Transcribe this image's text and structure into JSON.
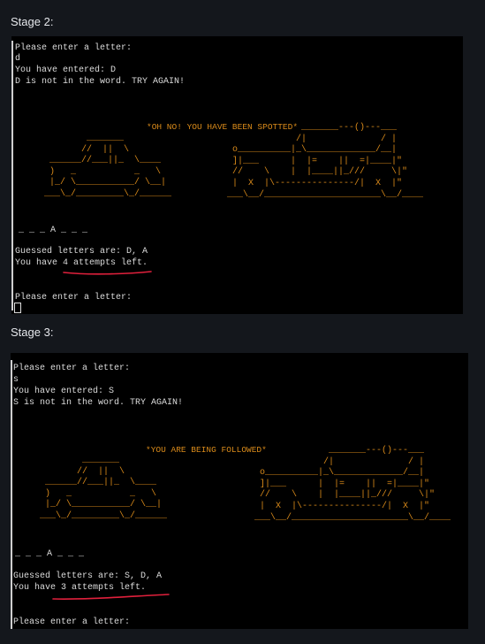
{
  "colors": {
    "page_bg": "#14171c",
    "terminal_bg": "#000000",
    "text": "#dcdcdc",
    "art": "#d98a1a",
    "underline": "#e0203c"
  },
  "stage2": {
    "heading": "Stage 2:",
    "prompt1": "Please enter a letter:",
    "input": "d",
    "entered": "You have entered: D",
    "result": "D is not in the word. TRY AGAIN!",
    "banner": "*OH NO! YOU HAVE BEEN SPOTTED*",
    "word": "_ _ _ A _ _ _",
    "guessed": "Guessed letters are: D, A",
    "attempts_prefix": "You have ",
    "attempts_emph": "4 attempts left.",
    "prompt2": "Please enter a letter:"
  },
  "stage3": {
    "heading": "Stage 3:",
    "prompt1": "Please enter a letter:",
    "input": "s",
    "entered": "You have entered: S",
    "result": "S is not in the word. TRY AGAIN!",
    "banner": "*YOU ARE BEING FOLLOWED*",
    "word": "_ _ _ A _ _ _",
    "guessed": "Guessed letters are: S, D, A",
    "attempts_prefix": "You have ",
    "attempts_emph": "3 attempts left.",
    "prompt2": "Please enter a letter:"
  },
  "art": {
    "car": "        _______\n       //  ||  \\\n ______//___||_  \\____\n )   _           _   \\\n |_/ \\___________/ \\__|\n___\\_/_________\\_/______",
    "van": "              _______---()---___\n             /|              / |\n o__________|_\\_____________/__|\n ]|___      |  |=    ||  =|____|\"\n //    \\    |  |____||_///     \\|\"\n |  X  |\\---------------/|  X  |\"\n___\\__/______________________\\__/____"
  }
}
